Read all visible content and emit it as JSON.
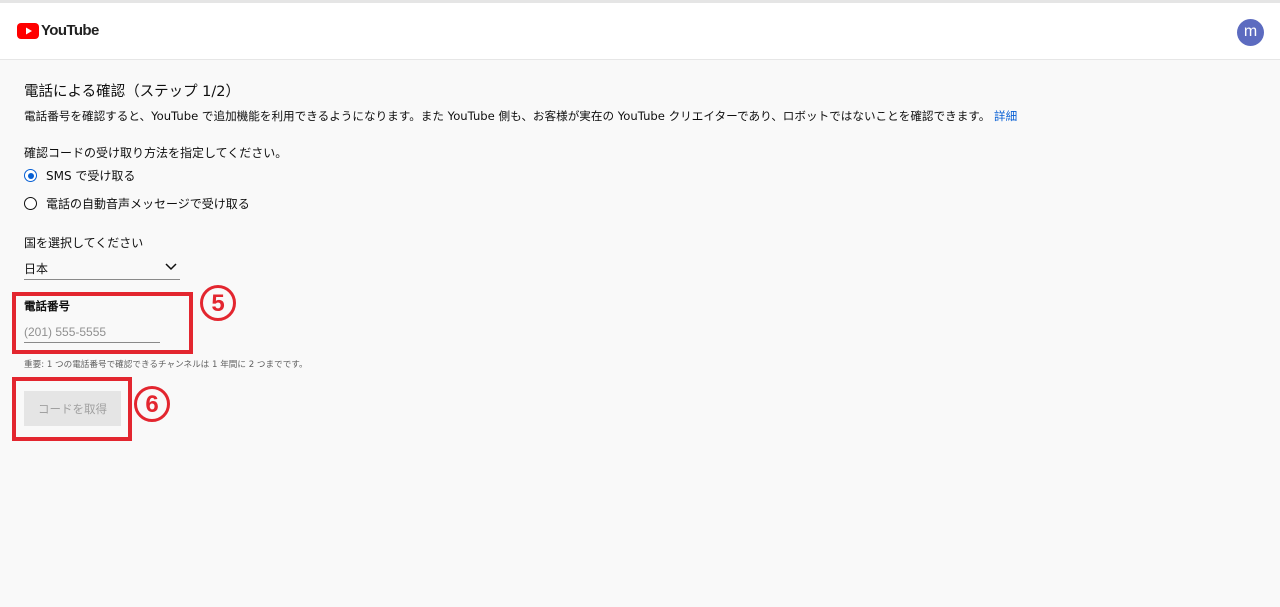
{
  "header": {
    "logo_text": "YouTube",
    "avatar_letter": "m"
  },
  "page": {
    "title": "電話による確認（ステップ 1/2）",
    "description": "電話番号を確認すると、YouTube で追加機能を利用できるようになります。また YouTube 側も、お客様が実在の YouTube クリエイターであり、ロボットではないことを確認できます。",
    "details_link": "詳細",
    "method_prompt": "確認コードの受け取り方法を指定してください。",
    "options": [
      {
        "label": "SMS で受け取る",
        "selected": true
      },
      {
        "label": "電話の自動音声メッセージで受け取る",
        "selected": false
      }
    ],
    "country_label": "国を選択してください",
    "country_value": "日本",
    "phone_label": "電話番号",
    "phone_placeholder": "(201) 555-5555",
    "phone_value": "",
    "note": "重要: 1 つの電話番号で確認できるチャンネルは 1 年間に 2 つまでです。",
    "get_code_button": "コードを取得"
  },
  "annotations": {
    "marker_5": "5",
    "marker_6": "6",
    "color": "#e3262f"
  },
  "colors": {
    "accent": "#065fd4",
    "brand": "#ff0000",
    "avatar": "#5c6bc0",
    "background": "#f9f9f9"
  }
}
